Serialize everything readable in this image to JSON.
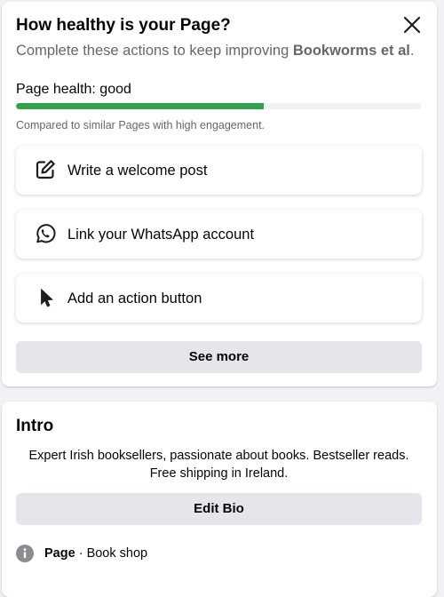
{
  "health_card": {
    "title": "How healthy is your Page?",
    "subtitle_prefix": "Complete these actions to keep improving ",
    "page_name": "Bookworms et al",
    "subtitle_suffix": ".",
    "health_label": "Page health: good",
    "health_progress_percent": 61,
    "progress_color": "#31a24c",
    "comparison_note": "Compared to similar Pages with high engagement.",
    "actions": [
      {
        "label": "Write a welcome post",
        "icon": "edit-post-icon"
      },
      {
        "label": "Link your WhatsApp account",
        "icon": "whatsapp-icon"
      },
      {
        "label": "Add an action button",
        "icon": "cursor-pointer-icon"
      }
    ],
    "see_more_label": "See more"
  },
  "intro_card": {
    "title": "Intro",
    "bio": "Expert Irish booksellers, passionate about books. Bestseller reads. Free shipping in Ireland.",
    "edit_bio_label": "Edit Bio",
    "page_type_label": "Page",
    "separator": " · ",
    "category": "Book shop"
  }
}
